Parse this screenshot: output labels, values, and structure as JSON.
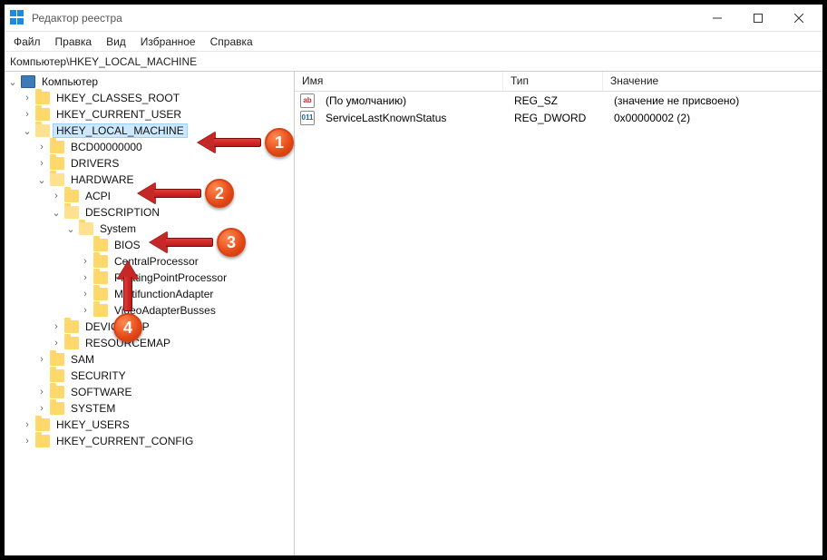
{
  "window": {
    "title": "Редактор реестра"
  },
  "menu": [
    "Файл",
    "Правка",
    "Вид",
    "Избранное",
    "Справка"
  ],
  "address": "Компьютер\\HKEY_LOCAL_MACHINE",
  "tree": {
    "root": "Компьютер",
    "hkcr": "HKEY_CLASSES_ROOT",
    "hkcu": "HKEY_CURRENT_USER",
    "hklm": "HKEY_LOCAL_MACHINE",
    "bcd": "BCD00000000",
    "drivers": "DRIVERS",
    "hardware": "HARDWARE",
    "acpi": "ACPI",
    "description": "DESCRIPTION",
    "system": "System",
    "bios": "BIOS",
    "cpu": "CentralProcessor",
    "fpp": "FloatingPointProcessor",
    "mfa": "MultifunctionAdapter",
    "vab": "VideoAdapterBusses",
    "devicemap": "DEVICEMAP",
    "resourcemap": "RESOURCEMAP",
    "sam": "SAM",
    "security": "SECURITY",
    "software": "SOFTWARE",
    "sys": "SYSTEM",
    "hku": "HKEY_USERS",
    "hkcc": "HKEY_CURRENT_CONFIG"
  },
  "list": {
    "headers": {
      "name": "Имя",
      "type": "Тип",
      "value": "Значение"
    },
    "rows": [
      {
        "icon": "sz",
        "name": "(По умолчанию)",
        "type": "REG_SZ",
        "value": "(значение не присвоено)"
      },
      {
        "icon": "dw",
        "name": "ServiceLastKnownStatus",
        "type": "REG_DWORD",
        "value": "0x00000002 (2)"
      }
    ]
  },
  "callouts": {
    "c1": "1",
    "c2": "2",
    "c3": "3",
    "c4": "4"
  }
}
